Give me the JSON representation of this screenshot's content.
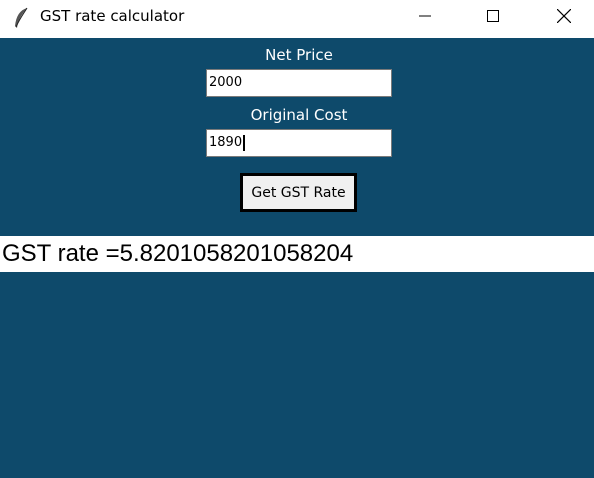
{
  "window": {
    "title": "GST rate calculator",
    "icon": "feather-icon",
    "controls": [
      "minimize-icon",
      "maximize-icon",
      "close-icon"
    ]
  },
  "form": {
    "net_price_label": "Net Price",
    "net_price_value": "2000",
    "original_cost_label": "Original Cost",
    "original_cost_value": "1890",
    "button_label": "Get GST Rate"
  },
  "result": {
    "text": "GST rate =5.8201058201058204"
  },
  "colors": {
    "background": "#0e4a6b",
    "label_text": "#ffffff"
  }
}
